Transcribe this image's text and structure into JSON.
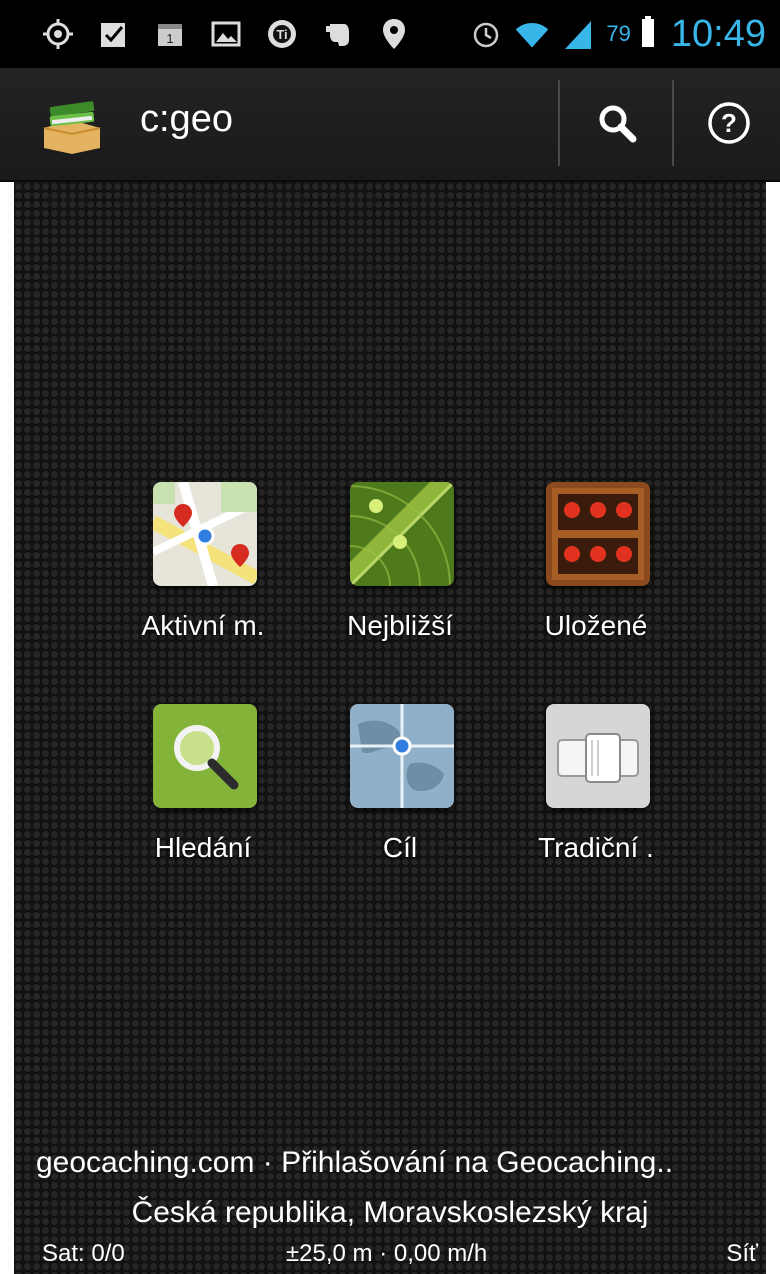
{
  "status_bar": {
    "icons": [
      "gps-icon",
      "checkbox-icon",
      "calendar-icon",
      "image-icon",
      "titanium-icon",
      "evernote-icon",
      "location-pin-icon"
    ],
    "right_icons": [
      "alarm-icon",
      "wifi-icon",
      "signal-icon"
    ],
    "battery": "79",
    "time": "10:49"
  },
  "action_bar": {
    "title": "c:geo",
    "search_icon": "search-icon",
    "help_icon": "help-icon"
  },
  "tiles": [
    {
      "label": "Aktivní m.",
      "icon": "live-map-icon"
    },
    {
      "label": "Nejbližší",
      "icon": "nearby-radar-icon"
    },
    {
      "label": "Uložené",
      "icon": "stored-caches-icon"
    },
    {
      "label": "Hledání",
      "icon": "search-magnifier-icon"
    },
    {
      "label": "Cíl",
      "icon": "destination-globe-icon"
    },
    {
      "label": "Tradiční .",
      "icon": "cache-type-filter-icon"
    }
  ],
  "footer": {
    "login_status": "geocaching.com · Přihlašování na Geocaching..",
    "location": "Česká republika, Moravskoslezský kraj",
    "satellites": "Sat: 0/0",
    "accuracy_speed": "±25,0 m · 0,00 m/h",
    "provider": "Síť"
  },
  "colors": {
    "accent": "#38b6e8",
    "background": "#121212"
  }
}
